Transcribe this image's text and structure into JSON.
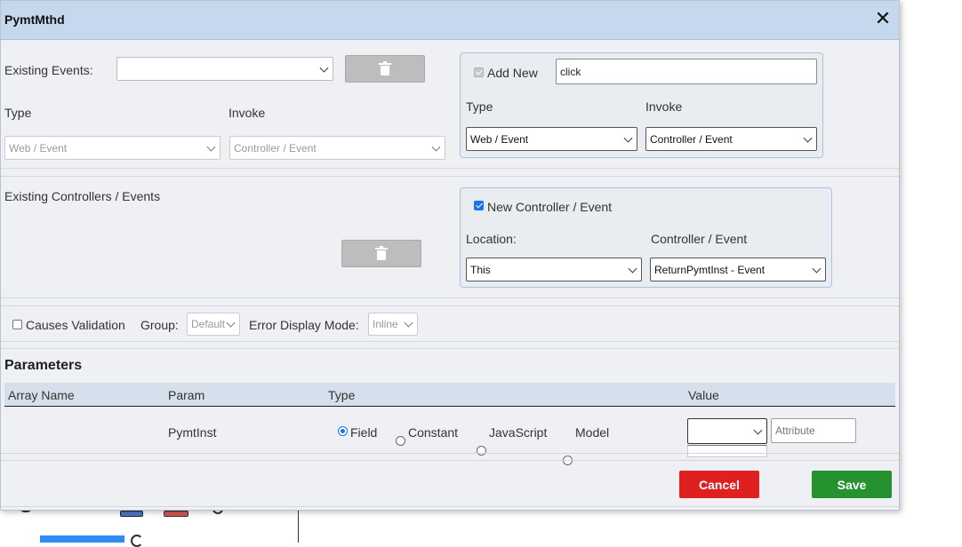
{
  "dialog": {
    "title": "PymtMthd",
    "close_glyph": "✕"
  },
  "existing_events": {
    "label": "Existing Events:",
    "value": "",
    "type_label": "Type",
    "invoke_label": "Invoke",
    "type_value": "Web / Event",
    "invoke_value": "Controller / Event"
  },
  "add_new": {
    "label": "Add New",
    "checked": true,
    "event_name": "click",
    "type_label": "Type",
    "invoke_label": "Invoke",
    "type_value": "Web / Event",
    "invoke_value": "Controller / Event"
  },
  "existing_controllers": {
    "label": "Existing Controllers / Events"
  },
  "new_controller": {
    "label": "New Controller / Event",
    "checked": true,
    "location_label": "Location:",
    "location_value": "This",
    "controller_label": "Controller / Event",
    "controller_value": "ReturnPymtInst - Event"
  },
  "validation": {
    "causes_validation_label": "Causes Validation",
    "group_label": "Group:",
    "group_value": "Default",
    "error_mode_label": "Error Display Mode:",
    "error_mode_value": "Inline"
  },
  "parameters": {
    "title": "Parameters",
    "columns": [
      "Array Name",
      "Param",
      "Type",
      "Value"
    ],
    "row": {
      "array_name": "",
      "param": "PymtInst",
      "type_options": [
        "Field",
        "Constant",
        "JavaScript",
        "Model"
      ],
      "selected_type": "Field",
      "value_select": "",
      "attribute_placeholder": "Attribute"
    }
  },
  "footer": {
    "cancel_label": "Cancel",
    "save_label": "Save"
  },
  "colors": {
    "titlebar": "#c5d8ee",
    "cancel": "#e02020",
    "save": "#25912f",
    "accent": "#1a73e8"
  },
  "icons": [
    "close-icon",
    "trash-icon",
    "chevron-down-icon"
  ]
}
